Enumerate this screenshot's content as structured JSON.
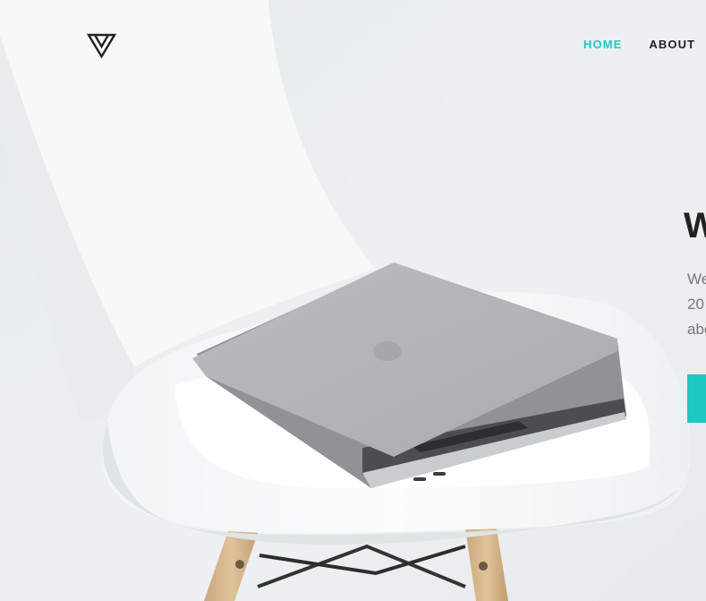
{
  "brand": {
    "logo_icon": "triangle-v-logo-icon"
  },
  "nav": {
    "items": [
      {
        "label": "HOME",
        "active": true
      },
      {
        "label": "ABOUT",
        "active": false
      }
    ]
  },
  "hero": {
    "title": "W",
    "text_lines": [
      "We",
      "20",
      "abo"
    ],
    "button_label": "",
    "image": "laptop-on-white-chair-photo"
  },
  "colors": {
    "accent": "#1ec8c3",
    "text_dark": "#222222",
    "text_muted": "#777777",
    "background": "#e9edee"
  }
}
